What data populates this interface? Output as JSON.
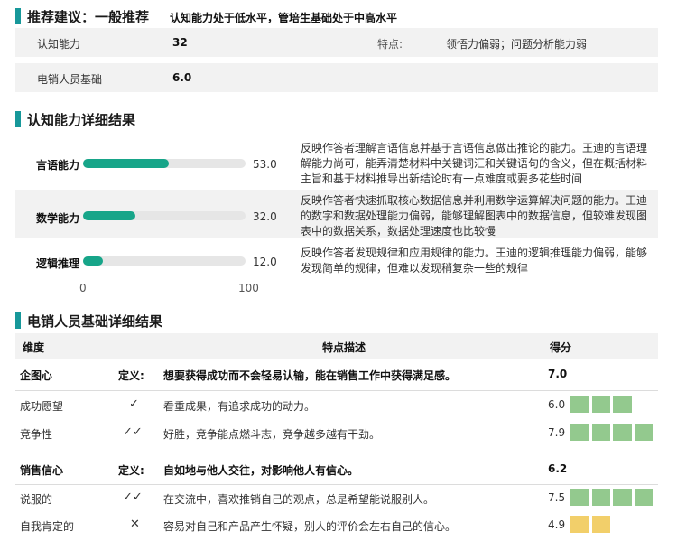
{
  "recommendation": {
    "label": "推荐建议：一般推荐",
    "note": "认知能力处于低水平，管培生基础处于中高水平"
  },
  "summary": {
    "cognitive_label": "认知能力",
    "cognitive_value": "32",
    "traits_label": "特点:",
    "traits_value": "领悟力偏弱；问题分析能力弱",
    "sales_label": "电销人员基础",
    "sales_value": "6.0"
  },
  "cognitive": {
    "title": "认知能力详细结果",
    "axis_min": "0",
    "axis_max": "100",
    "items": [
      {
        "name": "言语能力",
        "score": 53.0,
        "score_text": "53.0",
        "desc": "反映作答者理解言语信息并基于言语信息做出推论的能力。王迪的言语理解能力尚可，能弄清楚材料中关键词汇和关键语句的含义，但在概括材料主旨和基于材料推导出新结论时有一点难度或要多花些时间"
      },
      {
        "name": "数学能力",
        "score": 32.0,
        "score_text": "32.0",
        "desc": "反映作答者快速抓取核心数据信息并利用数学运算解决问题的能力。王迪的数字和数据处理能力偏弱，能够理解图表中的数据信息，但较难发现图表中的数据关系，数据处理速度也比较慢"
      },
      {
        "name": "逻辑推理",
        "score": 12.0,
        "score_text": "12.0",
        "desc": "反映作答者发现规律和应用规律的能力。王迪的逻辑推理能力偏弱，能够发现简单的规律，但难以发现稍复杂一些的规律"
      }
    ]
  },
  "sales": {
    "title": "电销人员基础详细结果",
    "headers": {
      "dimension": "维度",
      "description": "特点描述",
      "score": "得分"
    },
    "groups": [
      {
        "name": "企图心",
        "def_label": "定义:",
        "definition": "想要获得成功而不会轻易认输，能在销售工作中获得满足感。",
        "score": "7.0",
        "rows": [
          {
            "name": "成功愿望",
            "mark": "✓",
            "desc": "看重成果，有追求成功的动力。",
            "score": "6.0",
            "blocks": 3,
            "color": "#93c98e"
          },
          {
            "name": "竞争性",
            "mark": "✓✓",
            "desc": "好胜，竞争能点燃斗志，竞争越多越有干劲。",
            "score": "7.9",
            "blocks": 4,
            "color": "#93c98e"
          }
        ]
      },
      {
        "name": "销售信心",
        "def_label": "定义:",
        "definition": "自如地与他人交往，对影响他人有信心。",
        "score": "6.2",
        "rows": [
          {
            "name": "说服的",
            "mark": "✓✓",
            "desc": "在交流中，喜欢推销自己的观点，总是希望能说服别人。",
            "score": "7.5",
            "blocks": 4,
            "color": "#93c98e"
          },
          {
            "name": "自我肯定的",
            "mark": "✕",
            "desc": "容易对自己和产品产生怀疑，别人的评价会左右自己的信心。",
            "score": "4.9",
            "blocks": 2,
            "color": "#f2cf6a"
          }
        ]
      }
    ]
  }
}
